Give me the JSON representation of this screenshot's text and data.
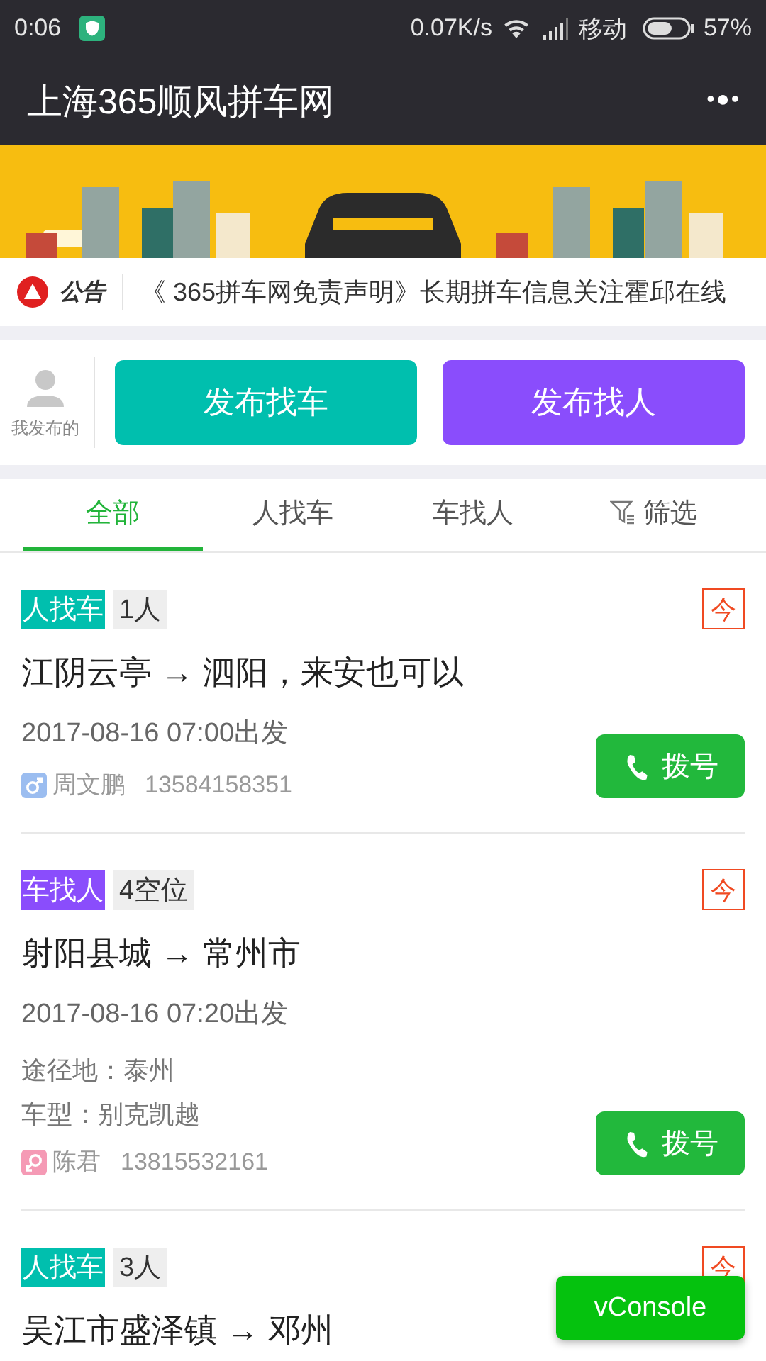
{
  "status_bar": {
    "time": "0:06",
    "speed": "0.07K/s",
    "carrier": "移动",
    "battery": "57%"
  },
  "nav_bar": {
    "title": "上海365顺风拼车网",
    "more": "•●•"
  },
  "notice": {
    "label": "公告",
    "text": "《 365拼车网免责声明》长期拼车信息关注霍邱在线"
  },
  "publish": {
    "mine": "我发布的",
    "buttons": [
      {
        "label": "发布找车",
        "kind": "passenger"
      },
      {
        "label": "发布找人",
        "kind": "driver"
      }
    ]
  },
  "tabs": [
    {
      "label": "全部",
      "selected": true,
      "kind": "text"
    },
    {
      "label": "人找车",
      "selected": false,
      "kind": "text"
    },
    {
      "label": "车找人",
      "selected": false,
      "kind": "text"
    },
    {
      "label": "筛选",
      "selected": false,
      "kind": "filter"
    }
  ],
  "posts": [
    {
      "kind": "passenger",
      "type_label": "人找车",
      "seats": "1人",
      "today": true,
      "today_label": "今",
      "route": "江阴云亭 → 泗阳，来安也可以",
      "time": "2017-08-16 07:00出发",
      "contact": {
        "kind": "male",
        "name": "周文鹏",
        "phone": "13584158351"
      },
      "call": "拨号"
    },
    {
      "kind": "driver",
      "type_label": "车找人",
      "seats": "4空位",
      "today": true,
      "today_label": "今",
      "route": "射阳县城 → 常州市",
      "time": "2017-08-16 07:20出发",
      "details": [
        "途径地：泰州",
        "车型：别克凯越"
      ],
      "contact": {
        "kind": "female",
        "name": "陈君",
        "phone": "13815532161"
      },
      "call": "拨号"
    },
    {
      "kind": "passenger",
      "type_label": "人找车",
      "seats": "3人",
      "today": true,
      "today_label": "今",
      "route": "吴江市盛泽镇 → 邓州"
    }
  ],
  "debug_button": "vConsole"
}
